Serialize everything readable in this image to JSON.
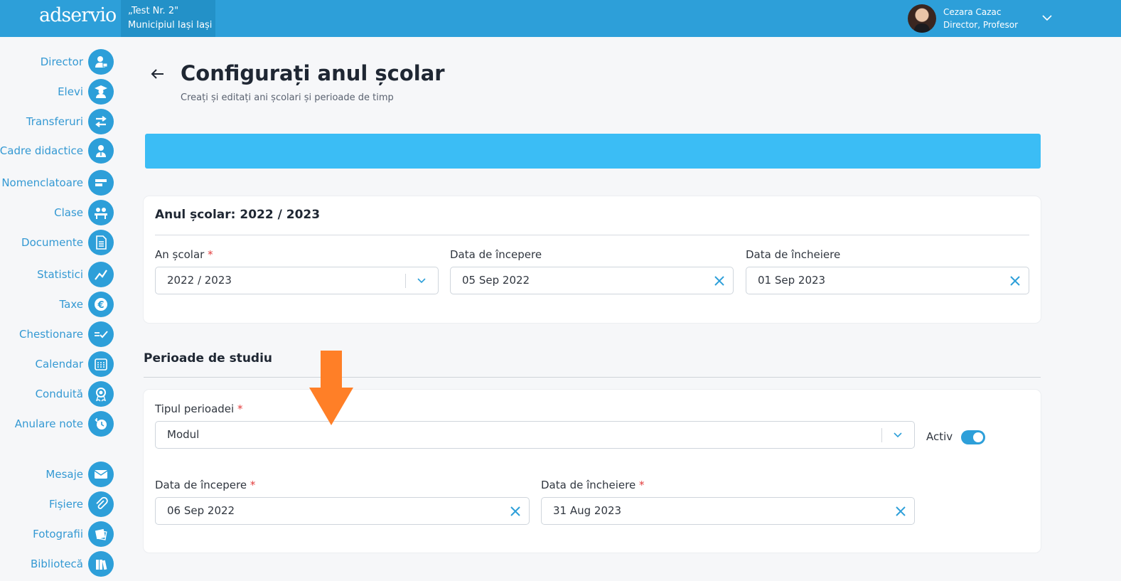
{
  "header": {
    "logo": "adservio",
    "school_name": "„Test Nr. 2\"",
    "school_location": "Municipiul Iași Iași",
    "user_name": "Cezara Cazac",
    "user_role": "Director, Profesor"
  },
  "sidebar": {
    "items": [
      {
        "label": "Director",
        "icon": "person-icon"
      },
      {
        "label": "Elevi",
        "icon": "graduate-icon"
      },
      {
        "label": "Transferuri",
        "icon": "transfer-arrows-icon"
      },
      {
        "label": "Cadre didactice",
        "icon": "teacher-icon"
      },
      {
        "label": "Nomenclatoare",
        "icon": "bars-icon"
      },
      {
        "label": "Clase",
        "icon": "classroom-icon"
      },
      {
        "label": "Documente",
        "icon": "document-icon"
      },
      {
        "label": "Statistici",
        "icon": "trend-line-icon"
      },
      {
        "label": "Taxe",
        "icon": "euro-icon"
      },
      {
        "label": "Chestionare",
        "icon": "checklist-icon"
      },
      {
        "label": "Calendar",
        "icon": "calendar-icon"
      },
      {
        "label": "Conduită",
        "icon": "badge-icon"
      },
      {
        "label": "Anulare note",
        "icon": "clock-hand-icon"
      },
      {
        "label": "Mesaje",
        "icon": "envelope-icon"
      },
      {
        "label": "Fișiere",
        "icon": "paperclip-icon"
      },
      {
        "label": "Fotografii",
        "icon": "photos-icon"
      },
      {
        "label": "Bibliotecă",
        "icon": "books-icon"
      }
    ]
  },
  "page": {
    "title": "Configurați anul școlar",
    "subtitle": "Creați și editați ani școlari și perioade de timp"
  },
  "school_year_card": {
    "title": "Anul școlar: 2022 / 2023",
    "year_label": "An școlar",
    "year_value": "2022 / 2023",
    "start_label": "Data de începere",
    "start_value": "05 Sep 2022",
    "end_label": "Data de încheiere",
    "end_value": "01 Sep 2023"
  },
  "periods": {
    "section_title": "Perioade de studiu",
    "type_label": "Tipul perioadei",
    "type_value": "Modul",
    "active_label": "Activ",
    "active": true,
    "start_label": "Data de începere",
    "start_value": "06 Sep 2022",
    "end_label": "Data de încheiere",
    "end_value": "31 Aug 2023",
    "required_mark": "*"
  },
  "colors": {
    "brand": "#2d9fd9",
    "banner": "#3bbdf5",
    "annotation_arrow": "#ff7f27",
    "required": "#e23c3c"
  }
}
